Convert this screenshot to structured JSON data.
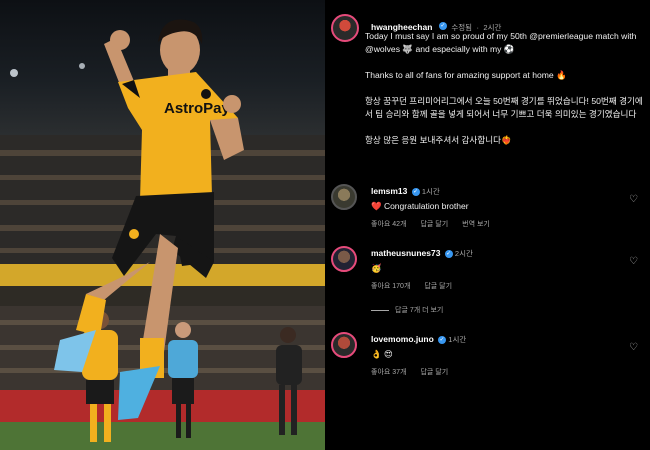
{
  "post": {
    "username": "hwangheechan",
    "edited_label": "수정됨",
    "time": "2시간",
    "caption": [
      "Today I must say I am so proud of my 50th @premierleague match with @wolves 🐺 and especially with my ⚽",
      "Thanks to all of fans for amazing support at home 🔥",
      "항상 꿈꾸던 프리미어리그에서 오늘 50번째 경기를 뛰었습니다! 50번째 경기에서 팀 승리와 함께 골을 넣게 되어서 너무 기쁘고 더욱 의미있는 경기였습니다",
      "항상 많은 응원 보내주셔서 감사합니다❤️‍🔥"
    ]
  },
  "photo": {
    "sponsor_text": "AstroPay"
  },
  "comments": [
    {
      "username": "lemsm13",
      "time": "1시간",
      "text": "❤️ Congratulation brother",
      "likes": "좋아요 42개",
      "reply": "답글 달기",
      "translate": "번역 보기"
    },
    {
      "username": "matheusnunes73",
      "time": "2시간",
      "text": "🥳",
      "likes": "좋아요 170개",
      "reply": "답글 달기",
      "view_replies": "답글 7개 더 보기"
    },
    {
      "username": "lovemomo.juno",
      "time": "1시간",
      "text": "👌 😍",
      "likes": "좋아요 37개",
      "reply": "답글 달기"
    }
  ],
  "colors": {
    "kit_gold": "#f2b01e",
    "verified_blue": "#3897f0",
    "muted": "#a8a8a8"
  }
}
